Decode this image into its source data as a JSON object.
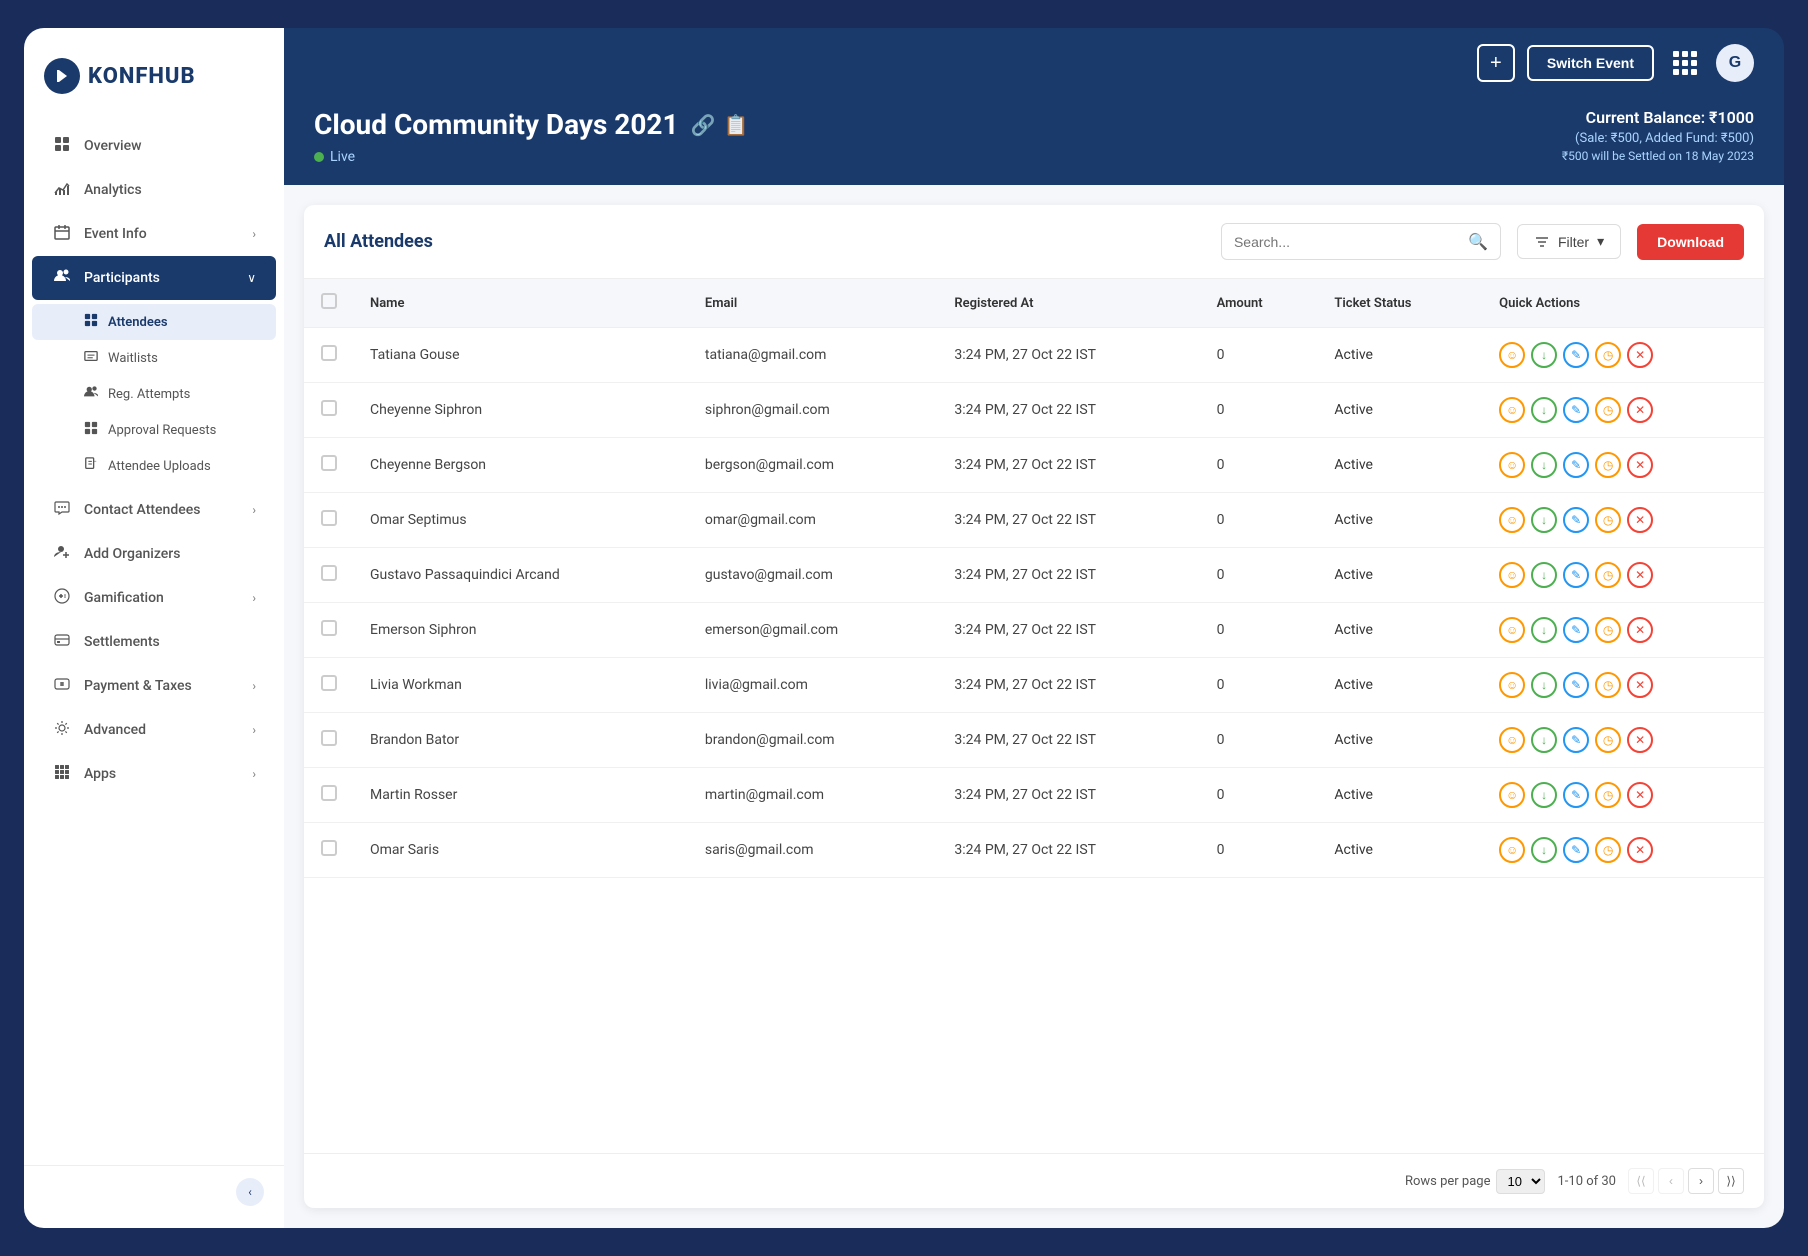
{
  "app": {
    "name": "KONFHUB",
    "logo_icon": "❮"
  },
  "header": {
    "switch_event_label": "Switch Event",
    "plus_label": "+",
    "avatar_label": "G"
  },
  "event": {
    "title": "Cloud Community Days 2021",
    "status": "Live",
    "balance_label": "Current Balance: ₹1000",
    "balance_sub": "(Sale: ₹500, Added Fund: ₹500)",
    "balance_settle": "₹500 will be Settled on 18 May 2023"
  },
  "sidebar": {
    "items": [
      {
        "id": "overview",
        "label": "Overview",
        "icon": "⊞",
        "has_sub": false,
        "active": false
      },
      {
        "id": "analytics",
        "label": "Analytics",
        "icon": "📈",
        "has_sub": false,
        "active": false
      },
      {
        "id": "event-info",
        "label": "Event Info",
        "icon": "📅",
        "has_sub": true,
        "active": false
      },
      {
        "id": "participants",
        "label": "Participants",
        "icon": "👥",
        "has_sub": true,
        "active": true
      },
      {
        "id": "contact-attendees",
        "label": "Contact Attendees",
        "icon": "📬",
        "has_sub": true,
        "active": false
      },
      {
        "id": "add-organizers",
        "label": "Add Organizers",
        "icon": "👤",
        "has_sub": false,
        "active": false
      },
      {
        "id": "gamification",
        "label": "Gamification",
        "icon": "🎮",
        "has_sub": true,
        "active": false
      },
      {
        "id": "settlements",
        "label": "Settlements",
        "icon": "💳",
        "has_sub": false,
        "active": false
      },
      {
        "id": "payment-taxes",
        "label": "Payment & Taxes",
        "icon": "💰",
        "has_sub": true,
        "active": false
      },
      {
        "id": "advanced",
        "label": "Advanced",
        "icon": "⚙️",
        "has_sub": true,
        "active": false
      },
      {
        "id": "apps",
        "label": "Apps",
        "icon": "⚏",
        "has_sub": true,
        "active": false
      }
    ],
    "sub_items": [
      {
        "id": "attendees",
        "label": "Attendees",
        "icon": "⊞",
        "active": true
      },
      {
        "id": "waitlists",
        "label": "Waitlists",
        "icon": "📋",
        "active": false
      },
      {
        "id": "reg-attempts",
        "label": "Reg. Attempts",
        "icon": "👥",
        "active": false
      },
      {
        "id": "approval-requests",
        "label": "Approval Requests",
        "icon": "⊞",
        "active": false
      },
      {
        "id": "attendee-uploads",
        "label": "Attendee Uploads",
        "icon": "📄",
        "active": false
      }
    ]
  },
  "table": {
    "title": "All Attendees",
    "search_placeholder": "Search...",
    "filter_label": "Filter",
    "download_label": "Download",
    "columns": [
      "Name",
      "Email",
      "Registered At",
      "Amount",
      "Ticket Status",
      "Quick Actions"
    ],
    "rows": [
      {
        "name": "Tatiana Gouse",
        "email": "tatiana@gmail.com",
        "registered_at": "3:24 PM, 27 Oct 22 IST",
        "amount": "0",
        "status": "Active"
      },
      {
        "name": "Cheyenne Siphron",
        "email": "siphron@gmail.com",
        "registered_at": "3:24 PM, 27 Oct 22 IST",
        "amount": "0",
        "status": "Active"
      },
      {
        "name": "Cheyenne Bergson",
        "email": "bergson@gmail.com",
        "registered_at": "3:24 PM, 27 Oct 22 IST",
        "amount": "0",
        "status": "Active"
      },
      {
        "name": "Omar Septimus",
        "email": "omar@gmail.com",
        "registered_at": "3:24 PM, 27 Oct 22 IST",
        "amount": "0",
        "status": "Active"
      },
      {
        "name": "Gustavo Passaquindici Arcand",
        "email": "gustavo@gmail.com",
        "registered_at": "3:24 PM, 27 Oct 22 IST",
        "amount": "0",
        "status": "Active"
      },
      {
        "name": "Emerson Siphron",
        "email": "emerson@gmail.com",
        "registered_at": "3:24 PM, 27 Oct 22 IST",
        "amount": "0",
        "status": "Active"
      },
      {
        "name": "Livia Workman",
        "email": "livia@gmail.com",
        "registered_at": "3:24 PM, 27 Oct 22 IST",
        "amount": "0",
        "status": "Active"
      },
      {
        "name": "Brandon Bator",
        "email": "brandon@gmail.com",
        "registered_at": "3:24 PM, 27 Oct 22 IST",
        "amount": "0",
        "status": "Active"
      },
      {
        "name": "Martin Rosser",
        "email": "martin@gmail.com",
        "registered_at": "3:24 PM, 27 Oct 22 IST",
        "amount": "0",
        "status": "Active"
      },
      {
        "name": "Omar Saris",
        "email": "saris@gmail.com",
        "registered_at": "3:24 PM, 27 Oct 22 IST",
        "amount": "0",
        "status": "Active"
      }
    ],
    "pagination": {
      "rows_per_page_label": "Rows per page",
      "rows_per_page_value": "10",
      "range_label": "1-10 of 30"
    }
  }
}
